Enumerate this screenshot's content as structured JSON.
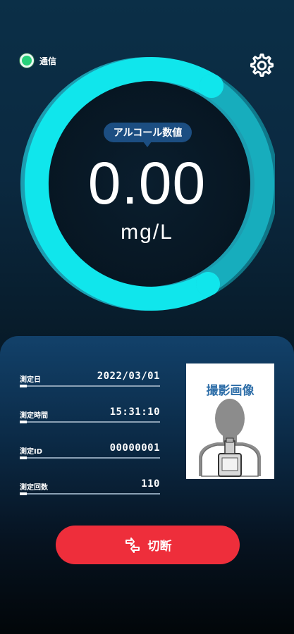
{
  "status": {
    "label": "通信",
    "connected": true,
    "color": "#27d07a"
  },
  "settings": {
    "icon": "gear-icon"
  },
  "gauge": {
    "bubble_label": "アルコール数値",
    "value": "0.00",
    "unit": "mg/L",
    "ring_color": "#11e3ea",
    "track_color": "#1aa3b4"
  },
  "info": {
    "rows": [
      {
        "label": "測定日",
        "value": "2022/03/01"
      },
      {
        "label": "測定時間",
        "value": "15:31:10"
      },
      {
        "label": "測定ID",
        "value": "00000001"
      },
      {
        "label": "測定回数",
        "value": "110"
      }
    ]
  },
  "photo": {
    "title": "撮影画像"
  },
  "disconnect": {
    "label": "切断",
    "icon": "disconnect-icon",
    "color": "#ee2e3b"
  }
}
